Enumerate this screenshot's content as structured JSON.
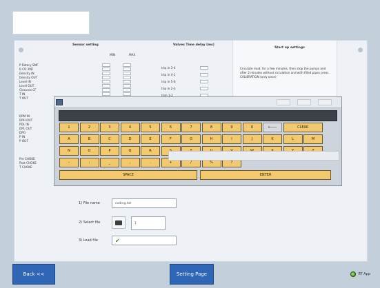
{
  "sensor": {
    "title": "Sensor setting",
    "min_label": "MIN",
    "max_label": "MAX",
    "labels": [
      "P Rotary SMF",
      "R CD 2MF",
      "Density IN",
      "Density OUT",
      "Level IN",
      "Level OUT",
      "Closures CF",
      "T IN",
      "T OUT",
      "DPM IN",
      "DPH OUT",
      "PDL IN",
      "DPL OUT",
      "DPO",
      "P IN",
      "P OUT",
      "Pre CHOKE",
      "Post CHOKE",
      "T CHOKE"
    ]
  },
  "valves": {
    "title": "Valves Time delay (ms)",
    "labels": [
      "trip in 3-4",
      "trip in 4-1",
      "trip in 5-6",
      "trip in 2-3",
      "trim 1-2"
    ]
  },
  "startup": {
    "title": "Start up settings",
    "text": "Circulate mud, for a few minutes, then stop the pumps and after 2 minutes without circulation and with filled pipes press CALIBRATION (only once)"
  },
  "keyboard": {
    "row1": [
      "1",
      "2",
      "3",
      "4",
      "5",
      "6",
      "7",
      "8",
      "9",
      "0"
    ],
    "backspace_glyph": "🡐",
    "clear": "CLEAR",
    "row2": [
      "A",
      "B",
      "C",
      "D",
      "E",
      "F",
      "G",
      "H",
      "I",
      "J",
      "K",
      "L",
      "M"
    ],
    "row3": [
      "N",
      "O",
      "P",
      "Q",
      "R",
      "S",
      "T",
      "U",
      "V",
      "W",
      "X",
      "Y",
      "Z"
    ],
    "row4": [
      "-",
      ":",
      "_",
      ",",
      ".",
      "+",
      "/",
      "%",
      "?"
    ],
    "space": "SPACE",
    "enter": "ENTER"
  },
  "file": {
    "name_label": "1) File name",
    "name_value": "coding.txt",
    "select_label": "2) Select file",
    "select_value": "1",
    "load_label": "3) Load file"
  },
  "footer": {
    "back": "Back <<",
    "setting_page": "Setting Page",
    "status": "RT App"
  },
  "colors": {
    "key": "#f2c96e",
    "button_blue": "#2f66b5",
    "panel": "#eef2f6"
  }
}
